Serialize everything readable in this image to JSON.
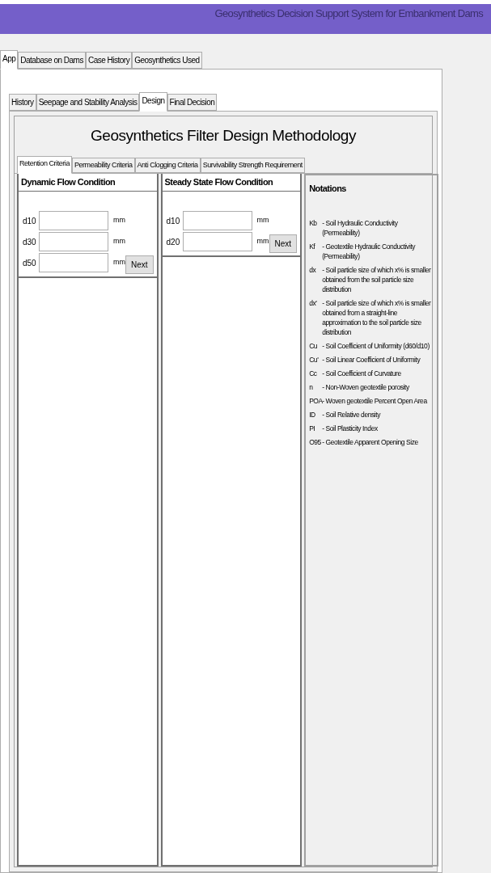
{
  "window": {
    "title": "Geosynthetics Decision Support System for Embankment Dams"
  },
  "main_tabs": [
    {
      "label": "App",
      "selected": true
    },
    {
      "label": "Database on Dams",
      "selected": false
    },
    {
      "label": "Case History",
      "selected": false
    },
    {
      "label": "Geosynthetics Used",
      "selected": false
    }
  ],
  "app_tabs": [
    {
      "label": "History",
      "selected": false
    },
    {
      "label": "Seepage and Stability Analysis",
      "selected": false
    },
    {
      "label": "Design",
      "selected": true
    },
    {
      "label": "Final Decision",
      "selected": false
    }
  ],
  "heading": "Geosynthetics Filter Design Methodology",
  "design_tabs": [
    {
      "label": "Retention Criteria",
      "selected": true
    },
    {
      "label": "Permeability Criteria",
      "selected": false
    },
    {
      "label": "Anti Clogging Criteria",
      "selected": false
    },
    {
      "label": "Survivability Strength Requirement",
      "selected": false
    }
  ],
  "panels": [
    {
      "title": "Dynamic Flow Condition",
      "fields": [
        {
          "label": "d10",
          "unit": "mm"
        },
        {
          "label": "d30",
          "unit": "mm"
        },
        {
          "label": "d50",
          "unit": "mm"
        }
      ],
      "button": "Next"
    },
    {
      "title": "Steady State Flow Condition",
      "fields": [
        {
          "label": "d10",
          "unit": "mm"
        },
        {
          "label": "d20",
          "unit": "mm"
        }
      ],
      "button": "Next"
    }
  ],
  "notations": {
    "title": "Notations",
    "items": [
      {
        "symbol": "Kb",
        "text": "- Soil Hydraulic Conductivity (Permeability)"
      },
      {
        "symbol": "Kf",
        "text": "- Geotextile Hydraulic Conductivity (Permeability)"
      },
      {
        "symbol": "dx",
        "text": "- Soil particle size of which x% is smaller obtained from the soil particle size distribution"
      },
      {
        "symbol": "dx'",
        "text": "- Soil particle size of which x% is smaller obtained from a straight-line approximation to the soil particle size distribution"
      },
      {
        "symbol": "Cu",
        "text": "- Soil Coefficient of Uniformity (d60/d10)"
      },
      {
        "symbol": "Cu'",
        "text": "- Soil Linear Coefficient of Uniformity"
      },
      {
        "symbol": "Cc",
        "text": "- Soil Coefficient of Curvature"
      },
      {
        "symbol": "n",
        "text": "- Non-Woven geotextile porosity"
      },
      {
        "symbol": "POA",
        "text": "- Woven geotextile Percent Open Area"
      },
      {
        "symbol": "ID",
        "text": "- Soil Relative density"
      },
      {
        "symbol": "PI",
        "text": "- Soil Plasticity Index"
      },
      {
        "symbol": "O95",
        "text": "- Geotextile Apparent Opening Size"
      }
    ]
  }
}
